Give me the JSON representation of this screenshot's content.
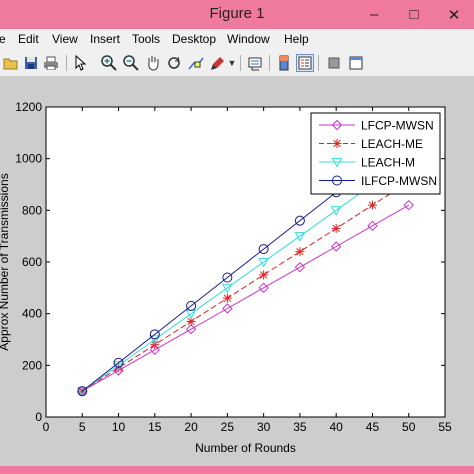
{
  "window": {
    "title": "Figure 1",
    "minimize_label": "–",
    "maximize_label": "□",
    "close_label": "✕"
  },
  "menu": {
    "items": [
      "e",
      "Edit",
      "View",
      "Insert",
      "Tools",
      "Desktop",
      "Window",
      "Help"
    ]
  },
  "toolbar": {
    "icons": [
      "open-icon",
      "save-icon",
      "print-icon",
      "pointer-icon",
      "zoom-in-icon",
      "zoom-out-icon",
      "pan-icon",
      "rotate-icon",
      "data-cursor-icon",
      "brush-icon",
      "dropdown-icon",
      "link-icon",
      "colorbar-icon",
      "legend-icon",
      "hide-tools-icon",
      "dock-icon"
    ]
  },
  "chart_data": {
    "type": "line",
    "xlabel": "Number of Rounds",
    "ylabel": "Approx Number of Transmissions",
    "xlim": [
      0,
      55
    ],
    "ylim": [
      0,
      1200
    ],
    "xticks": [
      0,
      5,
      10,
      15,
      20,
      25,
      30,
      35,
      40,
      45,
      50,
      55
    ],
    "yticks": [
      0,
      200,
      400,
      600,
      800,
      1000,
      1200
    ],
    "grid": false,
    "legend_position": "top-right",
    "x": [
      5,
      10,
      15,
      20,
      25,
      30,
      35,
      40,
      45,
      50
    ],
    "series": [
      {
        "name": "LFCP-MWSN",
        "color": "#cc33cc",
        "marker": "diamond",
        "line_style": "solid",
        "values": [
          100,
          180,
          260,
          340,
          420,
          500,
          580,
          660,
          740,
          820
        ]
      },
      {
        "name": "LEACH-ME",
        "color": "#e02020",
        "marker": "asterisk",
        "line_style": "dashed",
        "values": [
          100,
          190,
          280,
          370,
          460,
          550,
          640,
          730,
          820,
          910
        ]
      },
      {
        "name": "LEACH-M",
        "color": "#33dddd",
        "marker": "triangle-down",
        "line_style": "solid",
        "values": [
          100,
          200,
          300,
          400,
          500,
          600,
          700,
          800,
          900,
          1000
        ]
      },
      {
        "name": "ILFCP-MWSN",
        "color": "#1a1a8c",
        "marker": "circle",
        "line_style": "solid",
        "values": [
          100,
          210,
          320,
          430,
          540,
          650,
          760,
          870,
          980,
          1090
        ]
      }
    ]
  }
}
